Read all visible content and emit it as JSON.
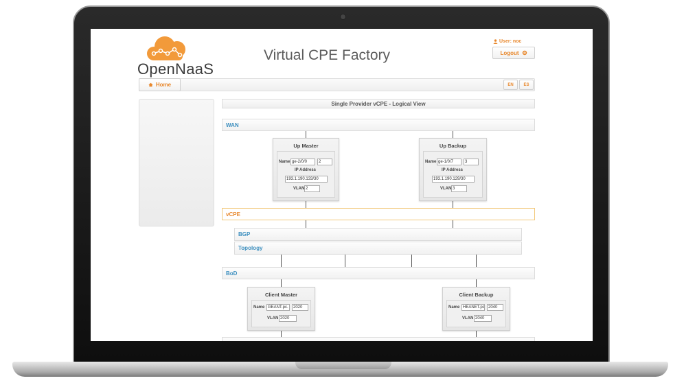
{
  "app": {
    "logo_text": "OpenNaaS",
    "title": "Virtual CPE Factory",
    "user_label": "User: noc",
    "logout_label": "Logout"
  },
  "nav": {
    "home_label": "Home",
    "lang_en": "EN",
    "lang_es": "ES"
  },
  "view_title": "Single Provider vCPE - Logical View",
  "sections": {
    "wan": "WAN",
    "vcpe": "vCPE",
    "bgp": "BGP",
    "topology": "Topology",
    "bod": "BoD"
  },
  "up_master": {
    "title": "Up Master",
    "name_label": "Name",
    "iface": "ge-2/0/0",
    "unit": "2",
    "ip_label": "IP Address",
    "ip": "193.1.190.133/30",
    "vlan_label": "VLAN",
    "vlan": "2"
  },
  "up_backup": {
    "title": "Up Backup",
    "name_label": "Name",
    "iface": "ge-1/0/7",
    "unit": "3",
    "ip_label": "IP Address",
    "ip": "193.1.190.129/30",
    "vlan_label": "VLAN",
    "vlan": "3"
  },
  "client_master": {
    "title": "Client Master",
    "name_label": "Name",
    "iface": "GEANT.pc.",
    "unit": "2020",
    "vlan_label": "VLAN",
    "vlan": "2020"
  },
  "client_backup": {
    "title": "Client Backup",
    "name_label": "Name",
    "iface": "HEANET.pc",
    "unit": "2040",
    "vlan_label": "VLAN",
    "vlan": "2040"
  },
  "colors": {
    "accent": "#e8872b",
    "link": "#3d8fbf"
  },
  "icons": [
    "camera-icon",
    "opennaas-cloud-logo",
    "user-icon",
    "gear-icon",
    "home-icon"
  ]
}
